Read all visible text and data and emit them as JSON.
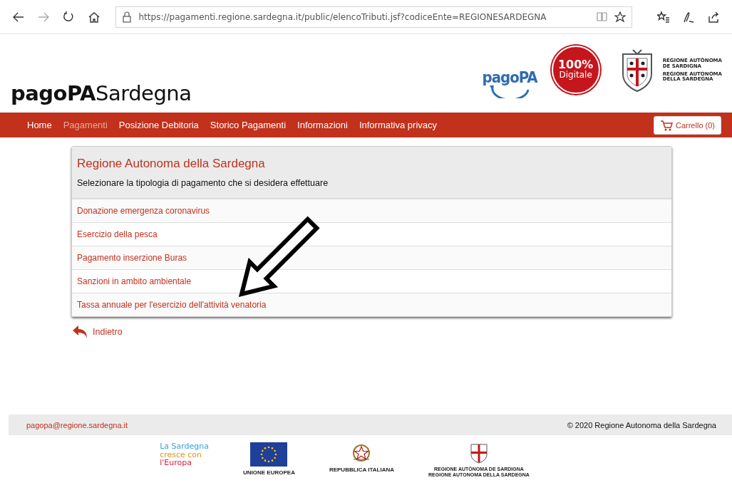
{
  "browser": {
    "url": "https://pagamenti.regione.sardegna.it/public/elencoTributi.jsf?codiceEnte=REGIONESARDEGNA",
    "forward_disabled": true
  },
  "header": {
    "brand": "**pagoPA**Sardegna",
    "pagopa_logo": "pagoPA",
    "badge": [
      "100%",
      "Digitale"
    ],
    "region_logo": [
      "REGIONE AUTÒNOMA",
      "DE SARDIGNA",
      "REGIONE AUTONOMA",
      "DELLA SARDEGNA"
    ]
  },
  "nav": {
    "items": [
      {
        "label": "Home",
        "selected": false
      },
      {
        "label": "Pagamenti",
        "selected": true
      },
      {
        "label": "Posizione Debitoria",
        "selected": false
      },
      {
        "label": "Storico Pagamenti",
        "selected": false
      },
      {
        "label": "Informazioni",
        "selected": false
      },
      {
        "label": "Informativa privacy",
        "selected": false
      }
    ],
    "cart": "Carrello (0)"
  },
  "card": {
    "title": "Regione Autonoma della Sardegna",
    "subtitle": "Selezionare la tipologia di pagamento che si desidera effettuare",
    "rows": [
      "Donazione emergenza coronavirus",
      "Esercizio della pesca",
      "Pagamento inserzione Buras",
      "Sanzioni in ambito ambientale",
      "Tassa annuale per l'esercizio dell'attività venatoria"
    ]
  },
  "back": "Indietro",
  "footer": {
    "email": "pagopa@regione.sardegna.it",
    "copyright": "© 2020 Regione Autonoma della Sardegna",
    "europa": [
      "La Sardegna",
      "cresce con",
      "l'Europa"
    ],
    "logos": [
      "UNIONE EUROPEA",
      "REPUBBLICA ITALIANA"
    ],
    "region": [
      "REGIONE AUTÒNOMA DE SARDIGNA",
      "REGIONE AUTONOMA DELLA SARDEGNA"
    ]
  }
}
